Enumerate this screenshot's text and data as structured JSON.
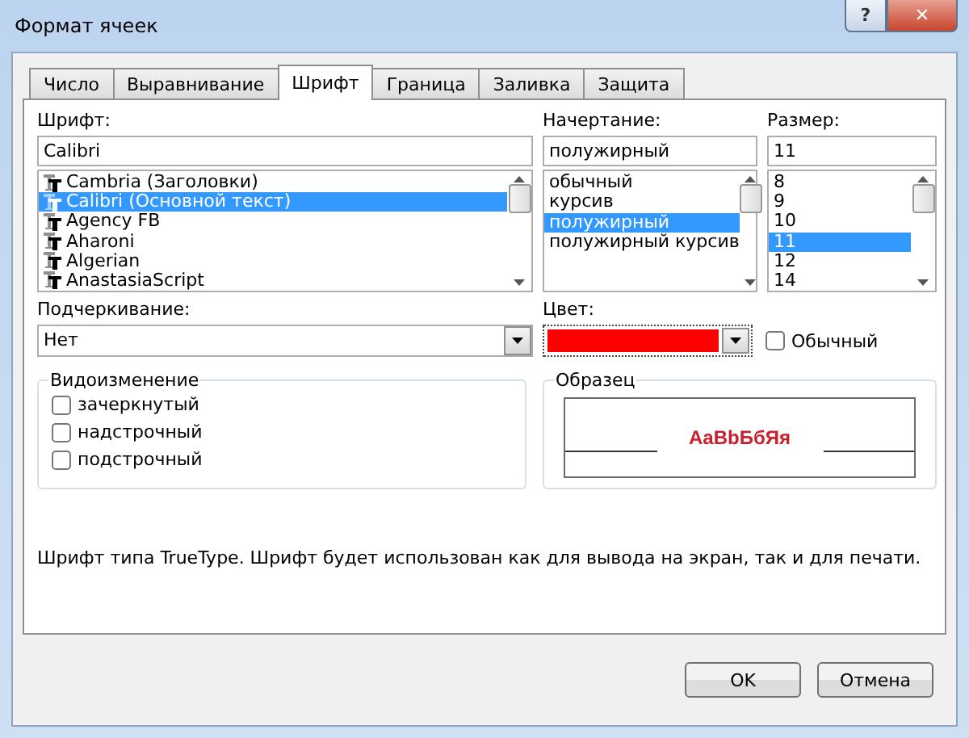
{
  "window": {
    "title": "Формат ячеек",
    "help": "?",
    "close": "✕"
  },
  "tabs": [
    {
      "label": "Число",
      "selected": false
    },
    {
      "label": "Выравнивание",
      "selected": false
    },
    {
      "label": "Шрифт",
      "selected": true
    },
    {
      "label": "Граница",
      "selected": false
    },
    {
      "label": "Заливка",
      "selected": false
    },
    {
      "label": "Защита",
      "selected": false
    }
  ],
  "font": {
    "label": "Шрифт:",
    "value": "Calibri",
    "items": [
      {
        "name": "Cambria (Заголовки)",
        "selected": false
      },
      {
        "name": "Calibri (Основной текст)",
        "selected": true
      },
      {
        "name": "Agency FB",
        "selected": false
      },
      {
        "name": "Aharoni",
        "selected": false
      },
      {
        "name": "Algerian",
        "selected": false
      },
      {
        "name": "AnastasiaScript",
        "selected": false
      }
    ]
  },
  "style": {
    "label": "Начертание:",
    "value": "полужирный",
    "items": [
      {
        "name": "обычный",
        "selected": false
      },
      {
        "name": "курсив",
        "selected": false
      },
      {
        "name": "полужирный",
        "selected": true
      },
      {
        "name": "полужирный курсив",
        "selected": false
      }
    ]
  },
  "size": {
    "label": "Размер:",
    "value": "11",
    "items": [
      {
        "name": "8",
        "selected": false
      },
      {
        "name": "9",
        "selected": false
      },
      {
        "name": "10",
        "selected": false
      },
      {
        "name": "11",
        "selected": true
      },
      {
        "name": "12",
        "selected": false
      },
      {
        "name": "14",
        "selected": false
      }
    ]
  },
  "underline": {
    "label": "Подчеркивание:",
    "value": "Нет"
  },
  "color": {
    "label": "Цвет:",
    "color": "#ff0000",
    "normal": {
      "label": "Обычный",
      "checked": false
    }
  },
  "effects": {
    "title": "Видоизменение",
    "items": [
      {
        "label": "зачеркнутый",
        "checked": false
      },
      {
        "label": "надстрочный",
        "checked": false
      },
      {
        "label": "подстрочный",
        "checked": false
      }
    ]
  },
  "sample": {
    "title": "Образец",
    "text": "AaBbБбЯя"
  },
  "description": "Шрифт типа TrueType. Шрифт будет использован как для вывода на экран, так и для печати.",
  "buttons": [
    "OK",
    "Отмена"
  ]
}
